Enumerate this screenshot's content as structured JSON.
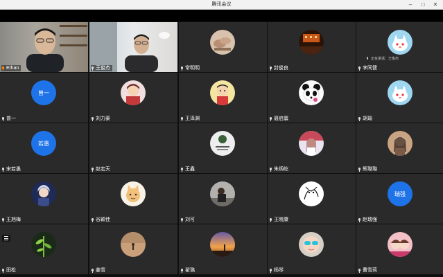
{
  "window": {
    "title": "腾讯会议"
  },
  "speaking_status": "正在讲话：王俊杰",
  "colors": {
    "tile_bg": "#2a2a2b",
    "text_avatar": "#1e73e8",
    "host_mic": "#ff8a00"
  },
  "participants": [
    {
      "name": "Ethan",
      "type": "video"
    },
    {
      "name": "王俊杰",
      "type": "video"
    },
    {
      "name": "常明明",
      "type": "photo",
      "icon": "hands-photo"
    },
    {
      "name": "封俊良",
      "type": "photo",
      "icon": "night-street-photo"
    },
    {
      "name": "李同健",
      "type": "photo",
      "icon": "cartoon-cat-photo"
    },
    {
      "name": "曾一",
      "type": "text",
      "avatar": "曾一"
    },
    {
      "name": "刘力豪",
      "type": "photo",
      "icon": "anime-character-photo"
    },
    {
      "name": "王泽渊",
      "type": "photo",
      "icon": "cartoon-boy-photo"
    },
    {
      "name": "聂启震",
      "type": "photo",
      "icon": "panda-photo"
    },
    {
      "name": "胡瑜",
      "type": "photo",
      "icon": "cartoon-cat-photo"
    },
    {
      "name": "宋若愚",
      "type": "text",
      "avatar": "若愚"
    },
    {
      "name": "赵宏天",
      "type": "photo",
      "icon": "cartoon-parrot-photo"
    },
    {
      "name": "王鑫",
      "type": "photo",
      "icon": "poster-photo"
    },
    {
      "name": "朱炳屹",
      "type": "photo",
      "icon": "anime-girl-photo"
    },
    {
      "name": "熊璐璐",
      "type": "photo",
      "icon": "girl-photo"
    },
    {
      "name": "王旭梅",
      "type": "photo",
      "icon": "anime-portrait-photo"
    },
    {
      "name": "谷颖佳",
      "type": "photo",
      "icon": "cat-drawing-photo"
    },
    {
      "name": "刘可",
      "type": "photo",
      "icon": "person-photo"
    },
    {
      "name": "王晓康",
      "type": "photo",
      "icon": "line-drawing-photo"
    },
    {
      "name": "赵瑞强",
      "type": "text",
      "avatar": "瑞强"
    },
    {
      "name": "田松",
      "type": "photo",
      "icon": "plant-photo"
    },
    {
      "name": "姜雪",
      "type": "photo",
      "icon": "desert-photo"
    },
    {
      "name": "翟璐",
      "type": "photo",
      "icon": "sunset-photo"
    },
    {
      "name": "杨琴",
      "type": "photo",
      "icon": "baby-sunglasses-photo"
    },
    {
      "name": "曹雪莉",
      "type": "photo",
      "icon": "kids-photo"
    }
  ]
}
